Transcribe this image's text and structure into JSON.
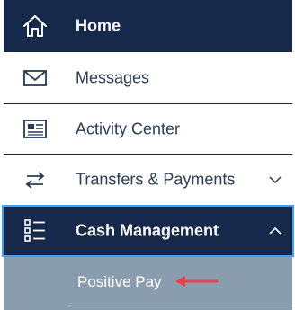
{
  "nav": {
    "items": [
      {
        "label": "Home",
        "icon": "home-icon"
      },
      {
        "label": "Messages",
        "icon": "envelope-icon"
      },
      {
        "label": "Activity Center",
        "icon": "newspaper-icon"
      },
      {
        "label": "Transfers & Payments",
        "icon": "transfer-arrows-icon",
        "expanded": false
      },
      {
        "label": "Cash Management",
        "icon": "list-icon",
        "expanded": true,
        "active": true
      }
    ],
    "sub_items": [
      {
        "label": "Positive Pay",
        "annotated": true
      }
    ]
  },
  "colors": {
    "navy": "#17294a",
    "active_border": "#3ea1f0",
    "sub_bg": "#8a9daf",
    "annotation_arrow": "#e8434a"
  }
}
